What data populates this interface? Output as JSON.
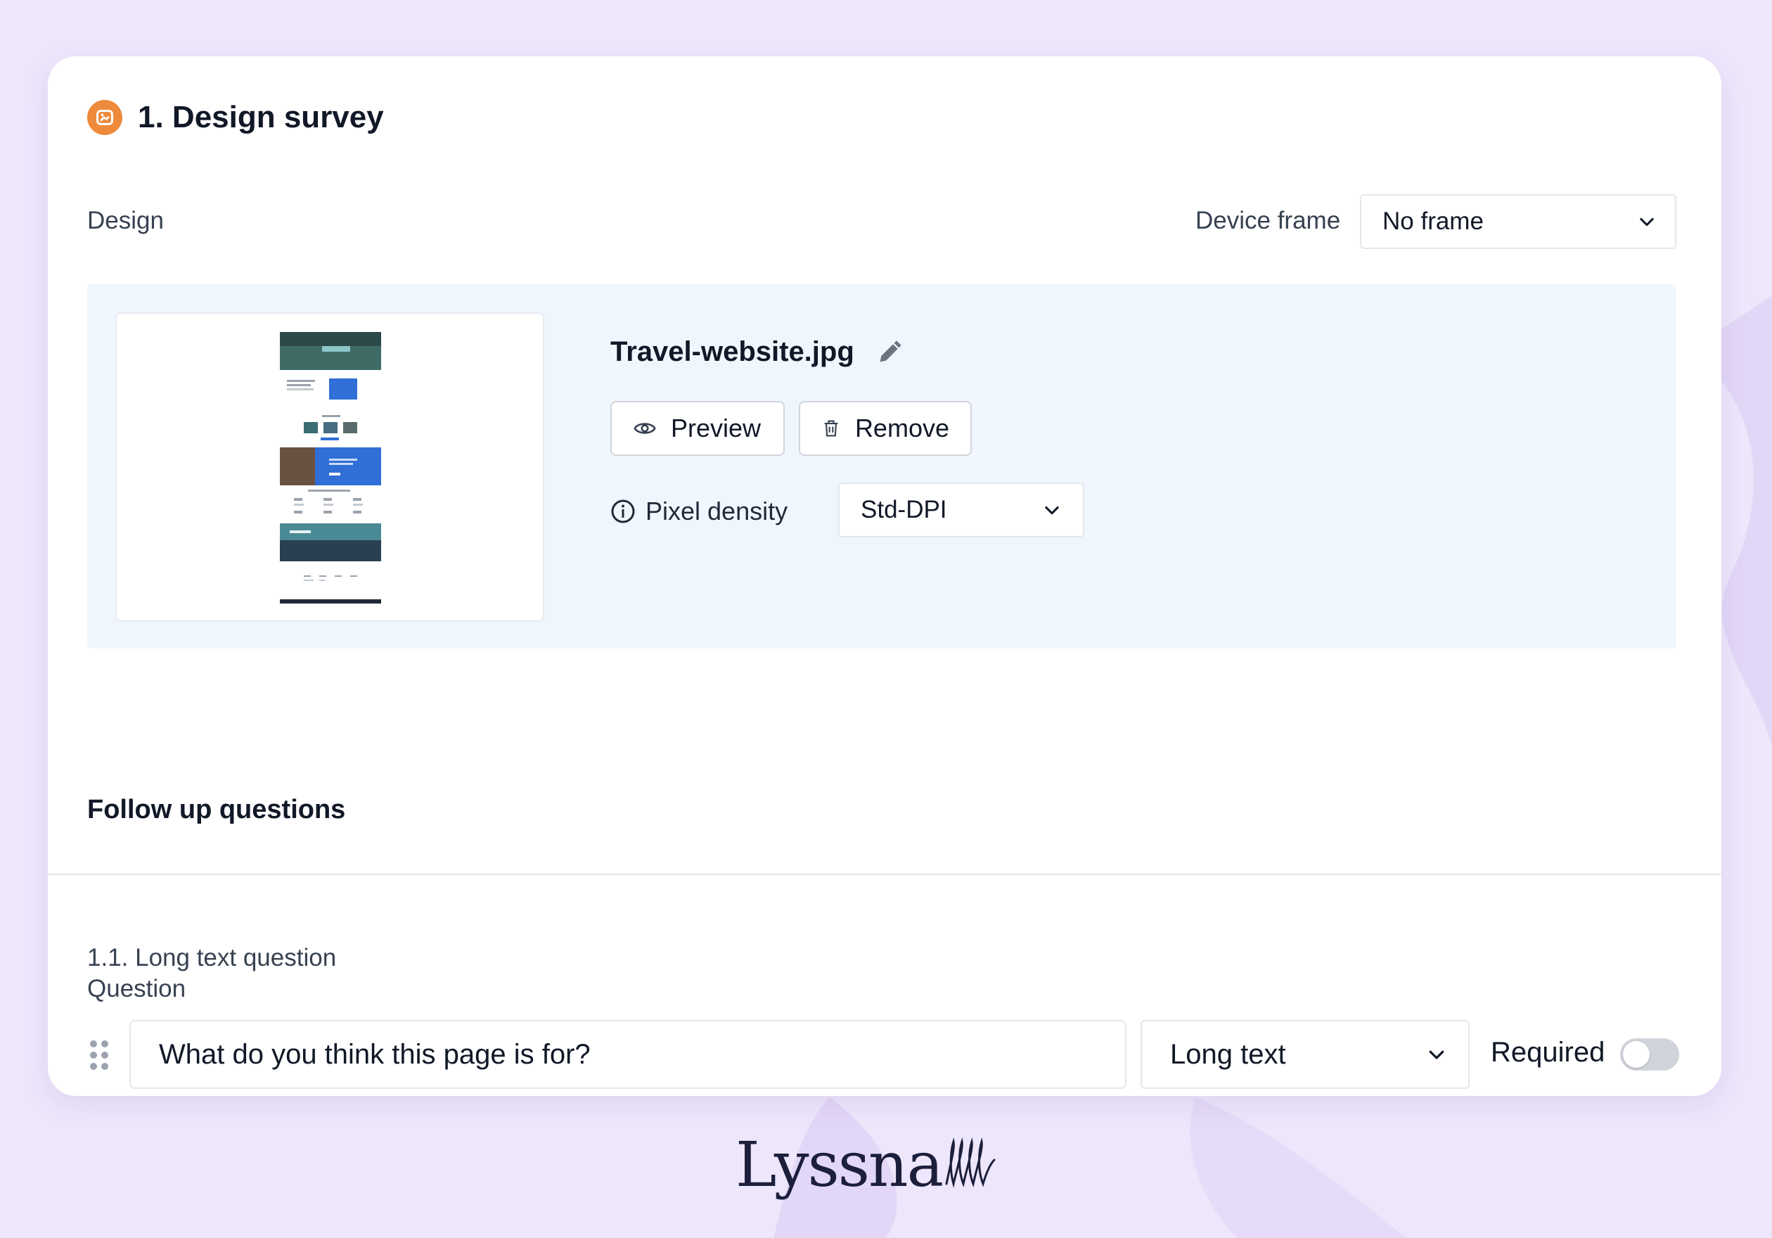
{
  "section": {
    "number_title": "1. Design survey",
    "icon": "image-icon",
    "accent": "#ee8a3b"
  },
  "design": {
    "label": "Design",
    "device_frame_label": "Device frame",
    "device_frame_value": "No frame",
    "file_name": "Travel-website.jpg",
    "preview_label": "Preview",
    "remove_label": "Remove",
    "pixel_density_label": "Pixel density",
    "pixel_density_value": "Std-DPI"
  },
  "followup": {
    "title": "Follow up questions",
    "question_number": "1.1. Long text question",
    "question_label": "Question",
    "question_value": "What do you think this page is for?",
    "type_value": "Long text",
    "required_label": "Required",
    "required_on": false
  },
  "brand": {
    "name": "Lyssna"
  }
}
